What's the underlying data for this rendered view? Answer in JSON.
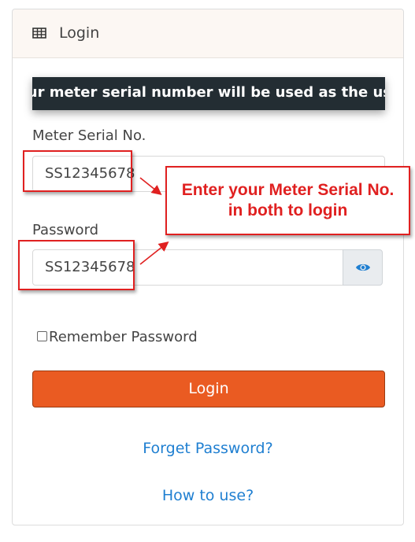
{
  "header": {
    "title": "Login",
    "icon": "table-icon"
  },
  "marquee": {
    "text": "Your meter serial number will be used as the user ID and the meter's serial number"
  },
  "form": {
    "serial_label": "Meter Serial No.",
    "serial_value": "SS12345678",
    "password_label": "Password",
    "password_value": "SS12345678",
    "show_password_icon": "eye-icon",
    "remember_label": "Remember Password",
    "remember_checked": false,
    "login_label": "Login"
  },
  "links": {
    "forget_password": "Forget Password?",
    "how_to_use": "How to use?"
  },
  "annotation": {
    "line1": "Enter your Meter Serial No.",
    "line2": "in both to login",
    "color": "#e02020"
  },
  "colors": {
    "primary_button": "#ea5b22",
    "link": "#1f7fd1",
    "marquee_bg": "#232d33",
    "header_bg": "#fcf7f3"
  }
}
